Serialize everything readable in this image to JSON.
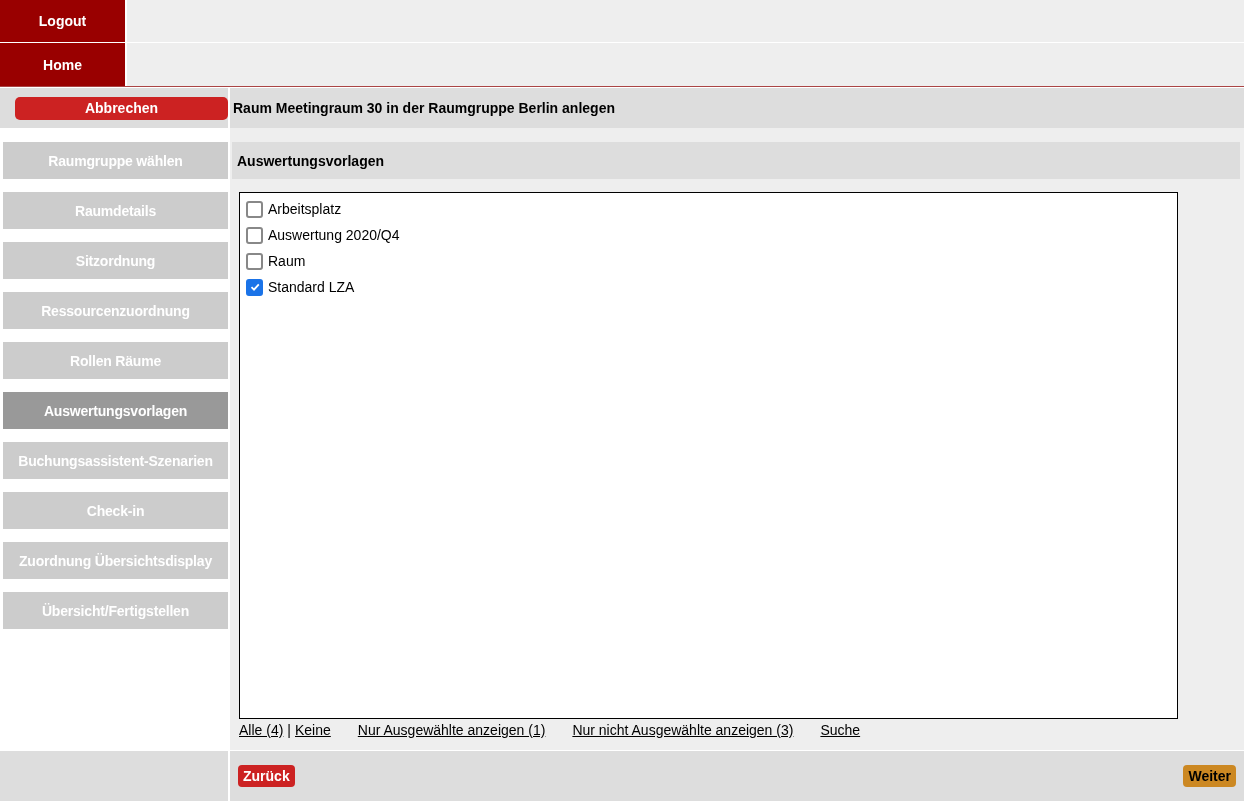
{
  "top_nav": [
    {
      "label": "Logout"
    },
    {
      "label": "Home"
    }
  ],
  "cancel_button": "Abbrechen",
  "page_title": "Raum Meetingraum 30 in der Raumgruppe Berlin anlegen",
  "steps": [
    {
      "label": "Raumgruppe wählen",
      "selected": false
    },
    {
      "label": "Raumdetails",
      "selected": false
    },
    {
      "label": "Sitzordnung",
      "selected": false
    },
    {
      "label": "Ressourcenzuordnung",
      "selected": false
    },
    {
      "label": "Rollen Räume",
      "selected": false
    },
    {
      "label": "Auswertungsvorlagen",
      "selected": true
    },
    {
      "label": "Buchungsassistent-Szenarien",
      "selected": false
    },
    {
      "label": "Check-in",
      "selected": false
    },
    {
      "label": "Zuordnung Übersichtsdisplay",
      "selected": false
    },
    {
      "label": "Übersicht/Fertigstellen",
      "selected": false
    }
  ],
  "section_title": "Auswertungsvorlagen",
  "templates": [
    {
      "label": "Arbeitsplatz",
      "checked": false
    },
    {
      "label": "Auswertung 2020/Q4",
      "checked": false
    },
    {
      "label": "Raum",
      "checked": false
    },
    {
      "label": "Standard LZA",
      "checked": true
    }
  ],
  "list_links": {
    "all": "Alle (4)",
    "separator": "|",
    "none": "Keine",
    "only_selected": "Nur Ausgewählte anzeigen (1)",
    "only_unselected": "Nur nicht Ausgewählte anzeigen (3)",
    "search": "Suche"
  },
  "footer": {
    "back": "Zurück",
    "next": "Weiter"
  }
}
